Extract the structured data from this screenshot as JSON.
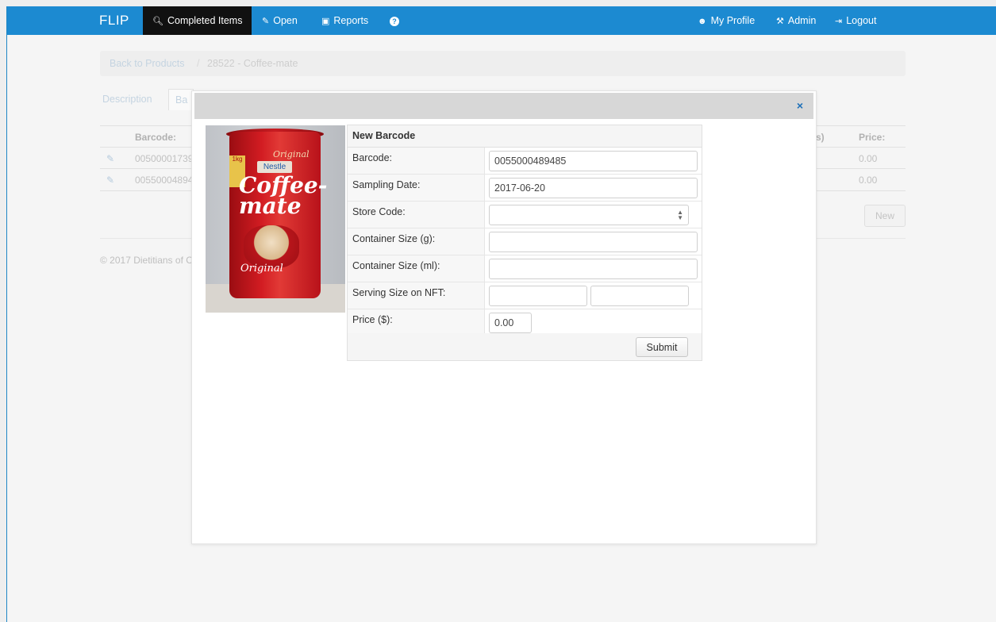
{
  "navbar": {
    "brand": "FLIP",
    "items": [
      {
        "label": "Completed Items",
        "icon": "search-icon",
        "active": true
      },
      {
        "label": "Open",
        "icon": "edit-icon"
      },
      {
        "label": "Reports",
        "icon": "picture-icon"
      },
      {
        "label": "",
        "icon": "question-icon"
      }
    ],
    "right_items": [
      {
        "label": "My Profile",
        "icon": "user-icon"
      },
      {
        "label": "Admin",
        "icon": "wrench-icon"
      },
      {
        "label": "Logout",
        "icon": "logout-icon"
      }
    ]
  },
  "background": {
    "breadcrumb": {
      "back": "Back to Products",
      "sep": "/",
      "current": "28522 - Coffee-mate"
    },
    "tabs": [
      "Description",
      "Ba"
    ],
    "table": {
      "headers": {
        "barcode": "Barcode:",
        "right_fragment": "s)",
        "price": "Price:"
      },
      "rows": [
        {
          "barcode": "00500001739",
          "price": "0.00"
        },
        {
          "barcode": "00550004894",
          "price": "0.00"
        }
      ]
    },
    "new_button": "New",
    "footer": "© 2017 Dietitians of C"
  },
  "modal": {
    "close_icon": "×",
    "photo": {
      "alt": "Coffee-mate product photo",
      "can_text_original_top": "Original",
      "can_text_brand": "Nestle",
      "can_text_product": "Coffee-mate",
      "can_text_original_bottom": "Original",
      "can_badge": "1kg"
    },
    "form": {
      "title": "New Barcode",
      "fields": {
        "barcode": {
          "label": "Barcode:",
          "value": "0055000489485"
        },
        "sampling_date": {
          "label": "Sampling Date:",
          "value": "2017-06-20"
        },
        "store_code": {
          "label": "Store Code:",
          "value": ""
        },
        "container_size_g": {
          "label": "Container Size (g):",
          "value": ""
        },
        "container_size_ml": {
          "label": "Container Size (ml):",
          "value": ""
        },
        "serving_size_nft": {
          "label": "Serving Size on NFT:",
          "value_1": "",
          "value_2": ""
        },
        "price": {
          "label": "Price ($):",
          "value": "0.00"
        }
      },
      "submit_label": "Submit"
    }
  },
  "colors": {
    "navbar": "#1c8ad1",
    "active_tab": "#111111",
    "close_icon": "#1c6fb8"
  }
}
